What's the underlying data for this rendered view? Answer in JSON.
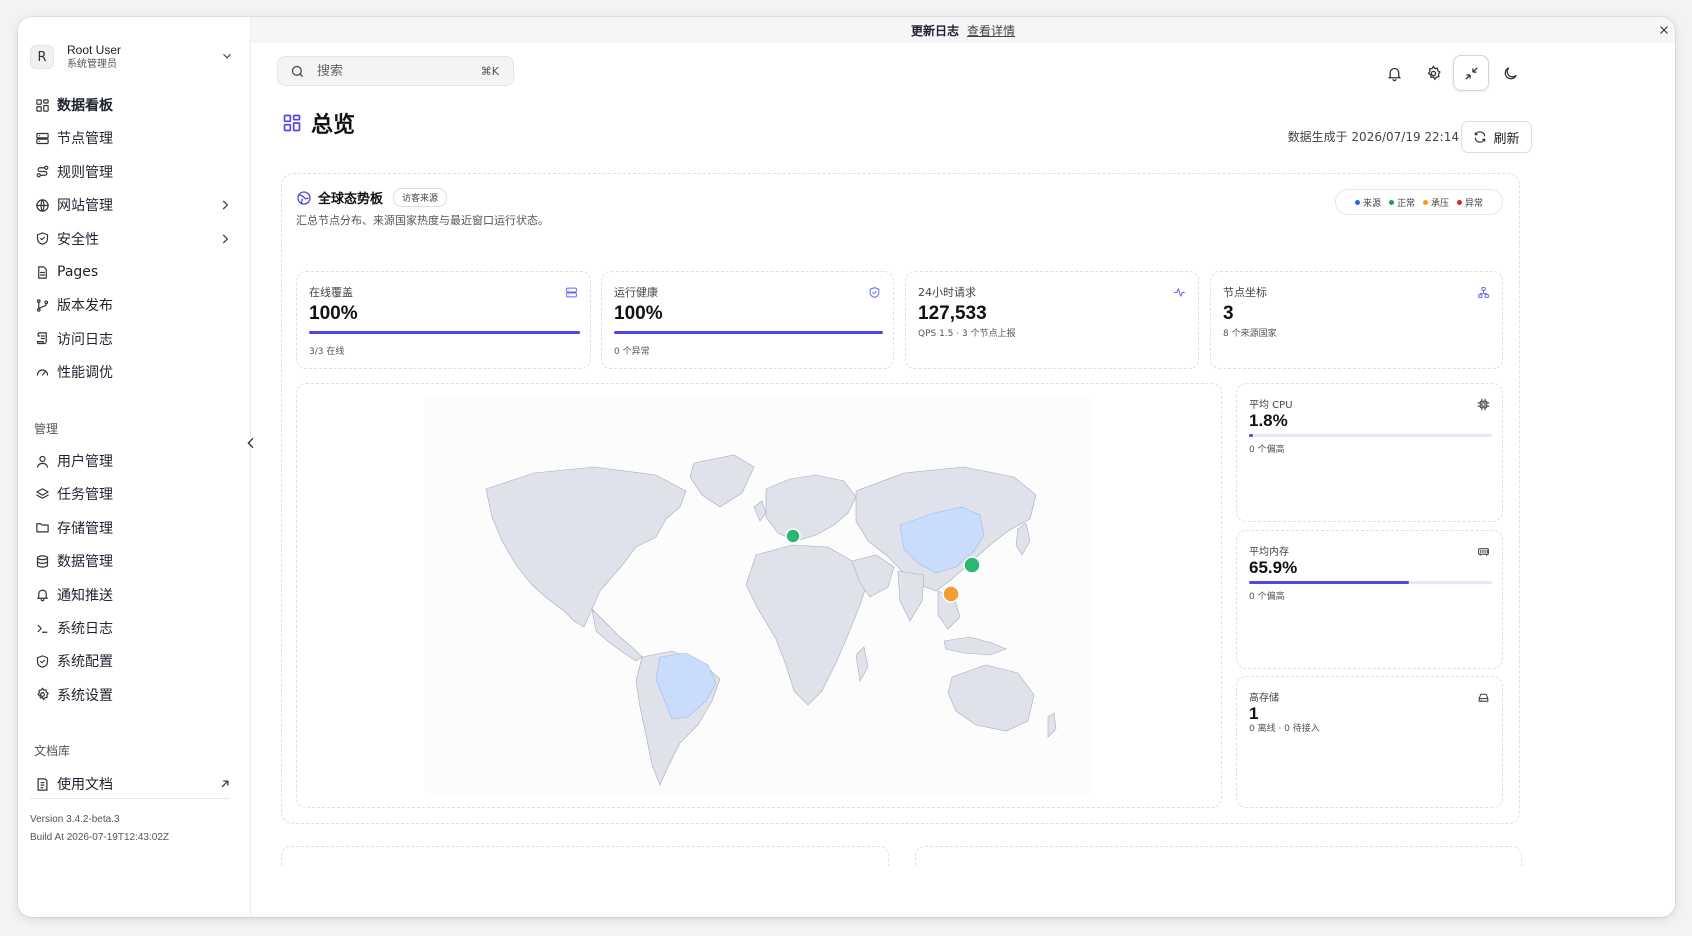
{
  "user": {
    "initial": "R",
    "name": "Root User",
    "role": "系统管理员"
  },
  "sidebar": {
    "main_items": [
      {
        "label": "数据看板",
        "icon": "dashboard-icon"
      },
      {
        "label": "节点管理",
        "icon": "server-icon"
      },
      {
        "label": "规则管理",
        "icon": "route-icon"
      },
      {
        "label": "网站管理",
        "icon": "globe-icon"
      },
      {
        "label": "安全性",
        "icon": "shield-icon"
      },
      {
        "label": "Pages",
        "icon": "file-icon"
      },
      {
        "label": "版本发布",
        "icon": "git-branch-icon"
      },
      {
        "label": "访问日志",
        "icon": "scroll-icon"
      },
      {
        "label": "性能调优",
        "icon": "gauge-icon"
      }
    ],
    "admin_section": "管理",
    "admin_items": [
      {
        "label": "用户管理",
        "icon": "user-icon"
      },
      {
        "label": "任务管理",
        "icon": "layers-icon"
      },
      {
        "label": "存储管理",
        "icon": "folder-icon"
      },
      {
        "label": "数据管理",
        "icon": "database-icon"
      },
      {
        "label": "通知推送",
        "icon": "bell-icon"
      },
      {
        "label": "系统日志",
        "icon": "terminal-icon"
      },
      {
        "label": "系统配置",
        "icon": "shield-check-icon"
      },
      {
        "label": "系统设置",
        "icon": "gear-icon"
      }
    ],
    "docs_section": "文档库",
    "docs_item": {
      "label": "使用文档",
      "icon": "book-icon"
    },
    "version": "Version 3.4.2-beta.3",
    "build": "Build At 2026-07-19T12:43:02Z"
  },
  "banner": {
    "title": "更新日志",
    "link": "查看详情"
  },
  "search": {
    "placeholder": "搜索",
    "shortcut": "⌘K"
  },
  "page": {
    "title": "总览",
    "generated": "数据生成于 2026/07/19 22:14",
    "refresh_label": "刷新"
  },
  "panel": {
    "title": "全球态势板",
    "badge": "访客来源",
    "description": "汇总节点分布、来源国家热度与最近窗口运行状态。",
    "legend": [
      {
        "label": "来源",
        "color": "#2563eb"
      },
      {
        "label": "正常",
        "color": "#16a34a"
      },
      {
        "label": "承压",
        "color": "#f59e0b"
      },
      {
        "label": "异常",
        "color": "#dc2626"
      }
    ]
  },
  "stats": [
    {
      "label": "在线覆盖",
      "value": "100%",
      "progress": 1.0,
      "sub": "3/3 在线",
      "icon": "server-icon"
    },
    {
      "label": "运行健康",
      "value": "100%",
      "progress": 1.0,
      "sub": "0 个异常",
      "icon": "shield-icon"
    },
    {
      "label": "24小时请求",
      "value": "127,533",
      "sub": "QPS 1.5 · 3 个节点上报",
      "icon": "activity-icon"
    },
    {
      "label": "节点坐标",
      "value": "3",
      "sub": "8 个来源国家",
      "icon": "network-icon"
    }
  ],
  "metrics": [
    {
      "label": "平均 CPU",
      "value": "1.8%",
      "progress": 0.018,
      "sub": "0 个偏高",
      "icon": "cpu-icon"
    },
    {
      "label": "平均内存",
      "value": "65.9%",
      "progress": 0.659,
      "sub": "0 个偏高",
      "icon": "memory-icon"
    },
    {
      "label": "高存储",
      "value": "1",
      "sub": "0 离线 · 0 待接入",
      "icon": "hard-drive-icon"
    }
  ],
  "map": {
    "source_countries": [
      "China",
      "Brazil"
    ],
    "nodes": [
      {
        "region": "Europe",
        "status": "正常",
        "color": "#2bb673"
      },
      {
        "region": "East China",
        "status": "正常",
        "color": "#2bb673"
      },
      {
        "region": "South China",
        "status": "承压",
        "color": "#f0a030"
      }
    ],
    "land_color": "#dfe2ea",
    "source_color": "#c9dcfb"
  }
}
